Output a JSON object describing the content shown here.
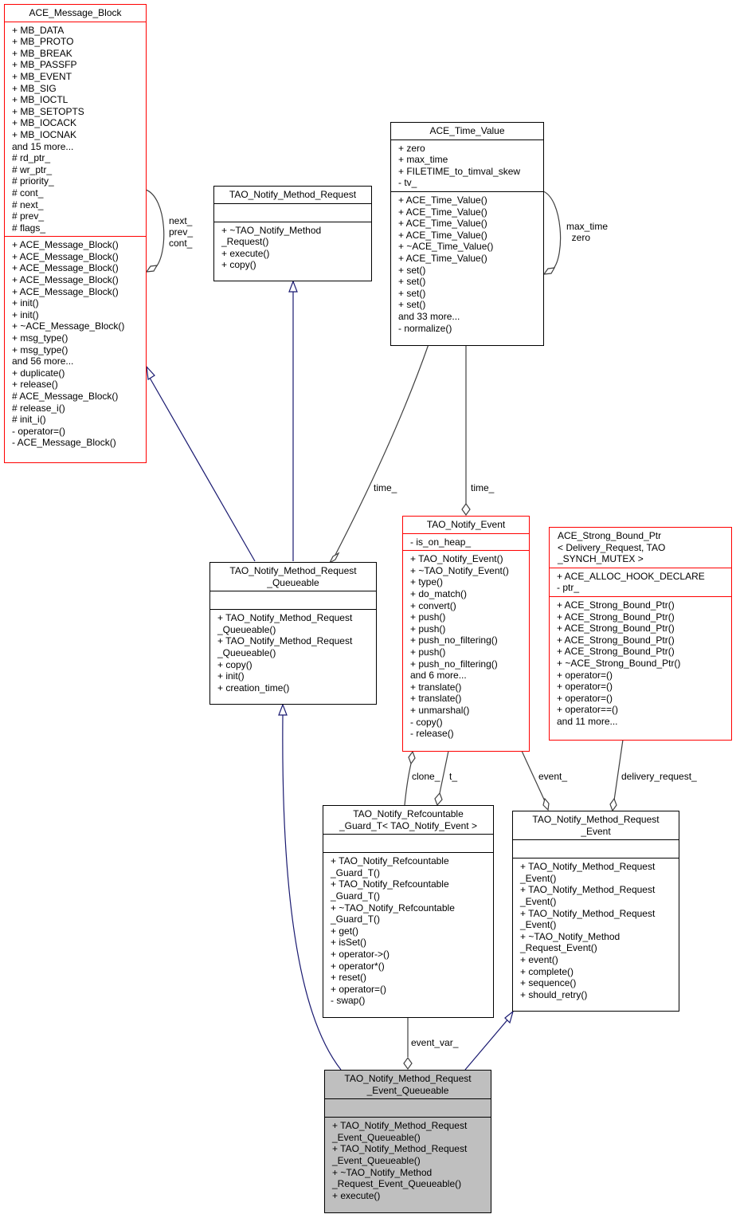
{
  "classes": {
    "ace_message_block": {
      "title": "ACE_Message_Block",
      "attributes": [
        "+ MB_DATA",
        "+ MB_PROTO",
        "+ MB_BREAK",
        "+ MB_PASSFP",
        "+ MB_EVENT",
        "+ MB_SIG",
        "+ MB_IOCTL",
        "+ MB_SETOPTS",
        "+ MB_IOCACK",
        "+ MB_IOCNAK",
        "and 15 more...",
        "# rd_ptr_",
        "# wr_ptr_",
        "# priority_",
        "# cont_",
        "# next_",
        "# prev_",
        "# flags_"
      ],
      "methods": [
        "+ ACE_Message_Block()",
        "+ ACE_Message_Block()",
        "+ ACE_Message_Block()",
        "+ ACE_Message_Block()",
        "+ ACE_Message_Block()",
        "+ init()",
        "+ init()",
        "+ ~ACE_Message_Block()",
        "+ msg_type()",
        "+ msg_type()",
        "and 56 more...",
        "+ duplicate()",
        "+ release()",
        "# ACE_Message_Block()",
        "# release_i()",
        "# init_i()",
        "- operator=()",
        "- ACE_Message_Block()"
      ]
    },
    "tao_notify_method_request": {
      "title": "TAO_Notify_Method_Request",
      "attributes": [],
      "methods": [
        "+ ~TAO_Notify_Method\n_Request()",
        "+ execute()",
        "+ copy()"
      ]
    },
    "ace_time_value": {
      "title": "ACE_Time_Value",
      "attributes": [
        "+ zero",
        "+ max_time",
        "+ FILETIME_to_timval_skew",
        "- tv_"
      ],
      "methods": [
        "+ ACE_Time_Value()",
        "+ ACE_Time_Value()",
        "+ ACE_Time_Value()",
        "+ ACE_Time_Value()",
        "+ ~ACE_Time_Value()",
        "+ ACE_Time_Value()",
        "+ set()",
        "+ set()",
        "+ set()",
        "+ set()",
        "and 33 more...",
        "- normalize()"
      ]
    },
    "tao_notify_method_request_queueable": {
      "title": "TAO_Notify_Method_Request\n_Queueable",
      "attributes": [],
      "methods": [
        "+ TAO_Notify_Method_Request\n_Queueable()",
        "+ TAO_Notify_Method_Request\n_Queueable()",
        "+ copy()",
        "+ init()",
        "+ creation_time()"
      ]
    },
    "tao_notify_event": {
      "title": "TAO_Notify_Event",
      "attributes": [
        "- is_on_heap_"
      ],
      "methods": [
        "+ TAO_Notify_Event()",
        "+ ~TAO_Notify_Event()",
        "+ type()",
        "+ do_match()",
        "+ convert()",
        "+ push()",
        "+ push()",
        "+ push_no_filtering()",
        "+ push()",
        "+ push_no_filtering()",
        "and 6 more...",
        "+ translate()",
        "+ translate()",
        "+ unmarshal()",
        "- copy()",
        "- release()"
      ]
    },
    "ace_strong_bound_ptr": {
      "title": "ACE_Strong_Bound_Ptr\n< Delivery_Request, TAO\n_SYNCH_MUTEX >",
      "attributes": [
        "+ ACE_ALLOC_HOOK_DECLARE",
        "- ptr_"
      ],
      "methods": [
        "+ ACE_Strong_Bound_Ptr()",
        "+ ACE_Strong_Bound_Ptr()",
        "+ ACE_Strong_Bound_Ptr()",
        "+ ACE_Strong_Bound_Ptr()",
        "+ ACE_Strong_Bound_Ptr()",
        "+ ~ACE_Strong_Bound_Ptr()",
        "+ operator=()",
        "+ operator=()",
        "+ operator=()",
        "+ operator==()",
        "and 11 more..."
      ]
    },
    "tao_notify_refcountable_guard_t": {
      "title": "TAO_Notify_Refcountable\n_Guard_T< TAO_Notify_Event >",
      "attributes": [],
      "methods": [
        "+ TAO_Notify_Refcountable\n_Guard_T()",
        "+ TAO_Notify_Refcountable\n_Guard_T()",
        "+ ~TAO_Notify_Refcountable\n_Guard_T()",
        "+ get()",
        "+ isSet()",
        "+ operator->()",
        "+ operator*()",
        "+ reset()",
        "+ operator=()",
        "- swap()"
      ]
    },
    "tao_notify_method_request_event": {
      "title": "TAO_Notify_Method_Request\n_Event",
      "attributes": [],
      "methods": [
        "+ TAO_Notify_Method_Request\n_Event()",
        "+ TAO_Notify_Method_Request\n_Event()",
        "+ TAO_Notify_Method_Request\n_Event()",
        "+ ~TAO_Notify_Method\n_Request_Event()",
        "+ event()",
        "+ complete()",
        "+ sequence()",
        "+ should_retry()"
      ]
    },
    "tao_notify_method_request_event_queueable": {
      "title": "TAO_Notify_Method_Request\n_Event_Queueable",
      "attributes": [],
      "methods": [
        "+ TAO_Notify_Method_Request\n_Event_Queueable()",
        "+ TAO_Notify_Method_Request\n_Event_Queueable()",
        "+ ~TAO_Notify_Method\n_Request_Event_Queueable()",
        "+ execute()"
      ]
    }
  },
  "edge_labels": {
    "mb_self": "next_\nprev_\ncont_",
    "tv_self": "max_time\n  zero",
    "time_queueable": "time_",
    "time_event": "time_",
    "clone": "clone_",
    "t": "t_",
    "event": "event_",
    "delivery_request": "delivery_request_",
    "event_var": "event_var_"
  },
  "colors": {
    "inheritance": "#191970",
    "usage": "#404040",
    "highlight_border": "#ff0000",
    "focus_fill": "#bfbfbf"
  }
}
